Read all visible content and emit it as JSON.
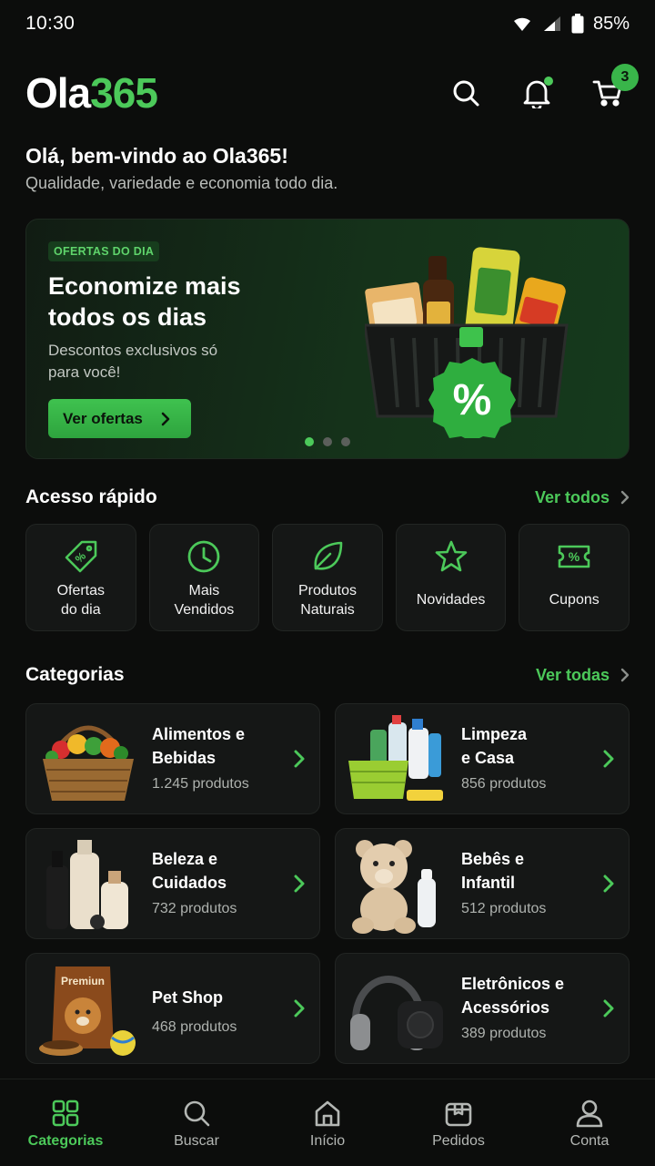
{
  "status": {
    "time": "10:30",
    "battery": "85%"
  },
  "header": {
    "logo_a": "Ola",
    "logo_b": "365",
    "cart_count": "3",
    "icons": [
      "search-icon",
      "bell-icon",
      "cart-icon"
    ]
  },
  "welcome": {
    "title": "Olá, bem-vindo ao Ola365!",
    "subtitle": "Qualidade, variedade e economia todo dia."
  },
  "banner": {
    "tag": "OFERTAS DO DIA",
    "title": "Economize mais todos os dias",
    "subtitle": "Descontos exclusivos só para você!",
    "button": "Ver ofertas",
    "badge_symbol": "%",
    "slides": 3,
    "active_slide": 1
  },
  "quick_access": {
    "title": "Acesso rápido",
    "link": "Ver todos",
    "items": [
      {
        "label": "Ofertas\ndo dia",
        "icon": "tag-percent-icon"
      },
      {
        "label": "Mais\nVendidos",
        "icon": "clock-icon"
      },
      {
        "label": "Produtos\nNaturais",
        "icon": "leaf-icon"
      },
      {
        "label": "Novidades",
        "icon": "star-icon"
      },
      {
        "label": "Cupons",
        "icon": "coupon-icon"
      }
    ]
  },
  "categories": {
    "title": "Categorias",
    "link": "Ver todas",
    "items": [
      {
        "name": "Alimentos e\nBebidas",
        "count": "1.245 produtos",
        "image": "produce-basket"
      },
      {
        "name": "Limpeza\ne Casa",
        "count": "856 produtos",
        "image": "cleaning-products"
      },
      {
        "name": "Beleza e\nCuidados",
        "count": "732 produtos",
        "image": "beauty-bottles"
      },
      {
        "name": "Bebês e\nInfantil",
        "count": "512 produtos",
        "image": "teddy-bear"
      },
      {
        "name": "Pet Shop",
        "count": "468 produtos",
        "image": "pet-food",
        "image_text": "Premiun"
      },
      {
        "name": "Eletrônicos e\nAcessórios",
        "count": "389 produtos",
        "image": "headphones"
      }
    ]
  },
  "nav": {
    "items": [
      {
        "label": "Categorias",
        "icon": "grid-icon",
        "active": true
      },
      {
        "label": "Buscar",
        "icon": "search-icon",
        "active": false
      },
      {
        "label": "Início",
        "icon": "home-icon",
        "active": false
      },
      {
        "label": "Pedidos",
        "icon": "box-icon",
        "active": false
      },
      {
        "label": "Conta",
        "icon": "user-icon",
        "active": false
      }
    ]
  },
  "colors": {
    "accent": "#4cc95a",
    "background": "#0c0d0c",
    "card": "#151716"
  }
}
